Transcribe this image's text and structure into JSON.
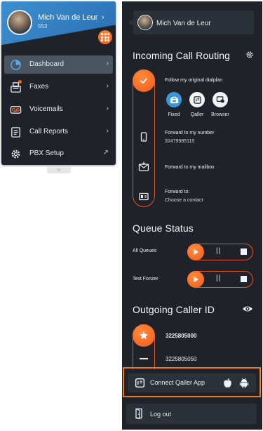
{
  "colors": {
    "panel_bg": "#1f2329",
    "accent_orange": "#ef5a1a",
    "blue_active": "#3b98d8",
    "header_blue": "#3d8fd0",
    "highlight_border": "#ef7b25"
  },
  "user": {
    "name": "Mich Van de Leur",
    "extension": "553"
  },
  "left_menu": {
    "items": [
      {
        "label": "Dashboard",
        "icon": "dashboard-icon",
        "active": true,
        "chevron": "›"
      },
      {
        "label": "Faxes",
        "icon": "fax-icon",
        "active": false,
        "chevron": "›",
        "badge": true
      },
      {
        "label": "Voicemails",
        "icon": "voicemail-icon",
        "active": false,
        "chevron": "›"
      },
      {
        "label": "Call Reports",
        "icon": "call-reports-icon",
        "active": false,
        "chevron": "›"
      },
      {
        "label": "PBX Setup",
        "icon": "gear-icon",
        "active": false,
        "chevron": "↗"
      }
    ],
    "collapse_label": "‹‹",
    "header_chevron": "›"
  },
  "routing": {
    "title": "Incoming Call Routing",
    "options": [
      {
        "label": "Follow my original dialplan",
        "selected": true
      },
      {
        "label": "Forward to my number",
        "sub": "32479985115"
      },
      {
        "label": "Forward to my mailbox"
      },
      {
        "label": "Forward to:",
        "sub": "Choose a contact"
      }
    ],
    "apps": [
      {
        "label": "Fixed",
        "active": true
      },
      {
        "label": "Qaller",
        "active": false
      },
      {
        "label": "Browser",
        "active": false
      }
    ]
  },
  "queue": {
    "title": "Queue Status",
    "queues": [
      {
        "label": "All Queues"
      },
      {
        "label": "Test Fonzer"
      }
    ],
    "pause_glyph": "||"
  },
  "caller_id": {
    "title": "Outgoing Caller ID",
    "numbers": [
      {
        "number": "3225805000",
        "selected": true
      },
      {
        "number": "3225805050",
        "selected": false
      }
    ]
  },
  "connect": {
    "label": "Connect Qaller App"
  },
  "logout": {
    "label": "Log out"
  }
}
